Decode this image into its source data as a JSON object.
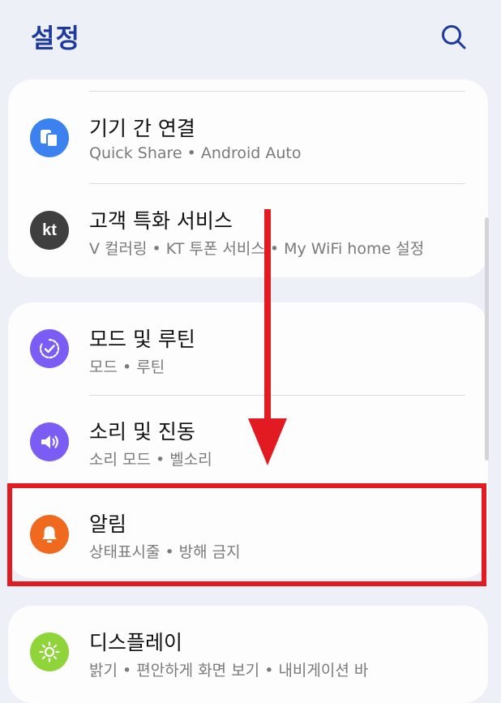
{
  "header": {
    "title": "설정",
    "search_icon": "search-icon"
  },
  "colors": {
    "title": "#1d3a9c",
    "connection_icon": "#3b82f0",
    "kt_icon": "#3f3f3f",
    "modes_icon": "#7b5cf5",
    "sound_icon": "#7b5cf5",
    "notifications_icon": "#ef6a1f",
    "display_icon": "#8fd438",
    "highlight": "#e21b23"
  },
  "sections": [
    {
      "items": [
        {
          "id": "connections",
          "icon": "devices-icon",
          "title": "기기 간 연결",
          "subtitle": "Quick Share  •  Android Auto"
        },
        {
          "id": "kt-services",
          "icon": "kt-logo-icon",
          "icon_text": "kt",
          "title": "고객 특화 서비스",
          "subtitle": "V 컬러링  •  KT 투폰 서비스  •  My WiFi home 설정"
        }
      ]
    },
    {
      "items": [
        {
          "id": "modes-routines",
          "icon": "modes-routines-icon",
          "title": "모드 및 루틴",
          "subtitle": "모드  •  루틴"
        },
        {
          "id": "sounds-vibration",
          "icon": "speaker-icon",
          "title": "소리 및 진동",
          "subtitle": "소리 모드  •  벨소리"
        },
        {
          "id": "notifications",
          "icon": "bell-icon",
          "title": "알림",
          "subtitle": "상태표시줄  •  방해 금지"
        }
      ]
    },
    {
      "items": [
        {
          "id": "display",
          "icon": "sun-icon",
          "title": "디스플레이",
          "subtitle": "밝기  •  편안하게 화면 보기  •  내비게이션 바"
        }
      ]
    }
  ]
}
